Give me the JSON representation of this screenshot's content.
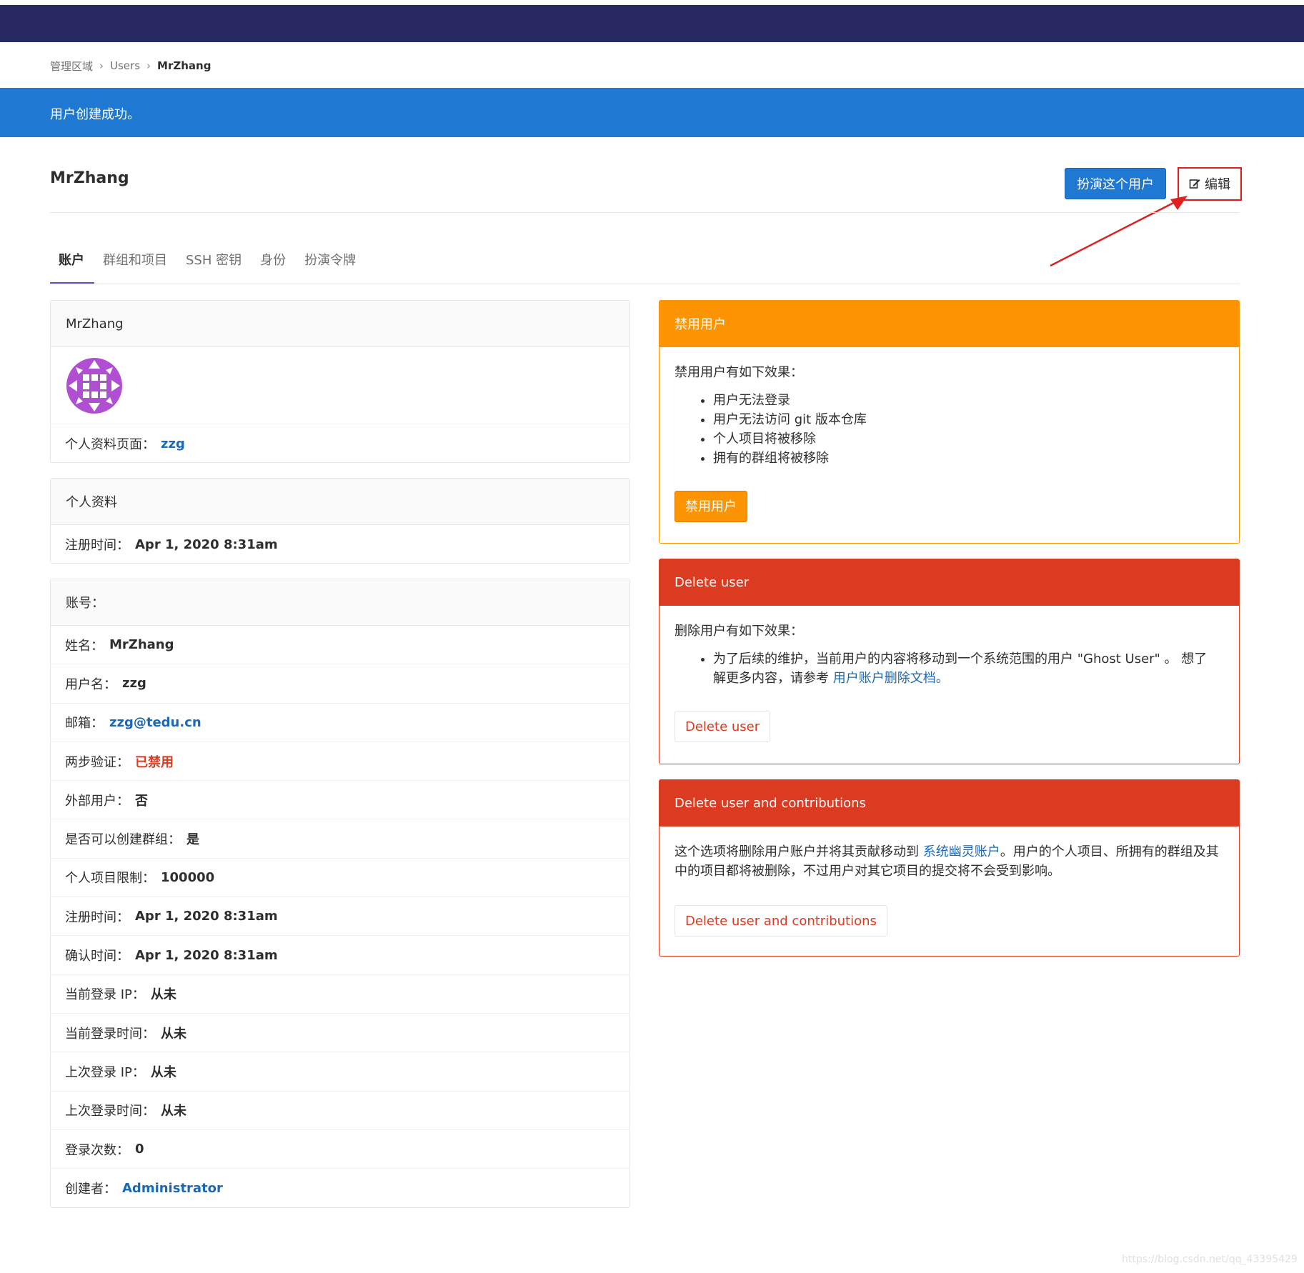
{
  "breadcrumb": [
    "管理区域",
    "Users",
    "MrZhang"
  ],
  "flash": "用户创建成功。",
  "page_title": "MrZhang",
  "actions": {
    "impersonate": "扮演这个用户",
    "edit": "编辑"
  },
  "tabs": [
    "账户",
    "群组和项目",
    "SSH 密钥",
    "身份",
    "扮演令牌"
  ],
  "profile_card": {
    "header": "MrZhang",
    "profile_page_label": "个人资料页面：",
    "profile_page_value": "zzg"
  },
  "profile_info": {
    "header": "个人资料",
    "rows": [
      {
        "k": "注册时间：",
        "v": "Apr 1, 2020 8:31am"
      }
    ]
  },
  "account": {
    "header": "账号：",
    "rows": [
      {
        "k": "姓名：",
        "v": "MrZhang"
      },
      {
        "k": "用户名：",
        "v": "zzg"
      },
      {
        "k": "邮箱：",
        "v": "zzg@tedu.cn"
      },
      {
        "k": "两步验证：",
        "v": "已禁用"
      },
      {
        "k": "外部用户：",
        "v": "否"
      },
      {
        "k": "是否可以创建群组：",
        "v": "是"
      },
      {
        "k": "个人项目限制：",
        "v": "100000"
      },
      {
        "k": "注册时间：",
        "v": "Apr 1, 2020 8:31am"
      },
      {
        "k": "确认时间：",
        "v": "Apr 1, 2020 8:31am"
      },
      {
        "k": "当前登录 IP：",
        "v": "从未"
      },
      {
        "k": "当前登录时间：",
        "v": "从未"
      },
      {
        "k": "上次登录 IP：",
        "v": "从未"
      },
      {
        "k": "上次登录时间：",
        "v": "从未"
      },
      {
        "k": "登录次数：",
        "v": "0"
      },
      {
        "k": "创建者：",
        "v": "Administrator"
      }
    ]
  },
  "block_panel": {
    "header": "禁用用户",
    "intro": "禁用用户有如下效果：",
    "items": [
      "用户无法登录",
      "用户无法访问 git 版本仓库",
      "个人项目将被移除",
      "拥有的群组将被移除"
    ],
    "button": "禁用用户"
  },
  "delete_panel": {
    "header": "Delete user",
    "intro": "删除用户有如下效果：",
    "item_text": "为了后续的维护，当前用户的内容将移动到一个系统范围的用户 \"Ghost User\" 。 想了解更多内容，请参考 ",
    "item_link": "用户账户删除文档。",
    "button": "Delete user"
  },
  "delete_contrib_panel": {
    "header": "Delete user and contributions",
    "text_before": "这个选项将删除用户账户并将其贡献移动到 ",
    "link": "系统幽灵账户",
    "text_after": "。用户的个人项目、所拥有的群组及其中的项目都将被删除，不过用户对其它项目的提交将不会受到影响。",
    "button": "Delete user and contributions"
  },
  "watermark": "https://blog.csdn.net/qq_43395429",
  "colors": {
    "navbar": "#292961",
    "primary": "#1f78d1",
    "warning": "#fc9403",
    "danger": "#db3b21",
    "tab_active": "#6b4fbb"
  }
}
